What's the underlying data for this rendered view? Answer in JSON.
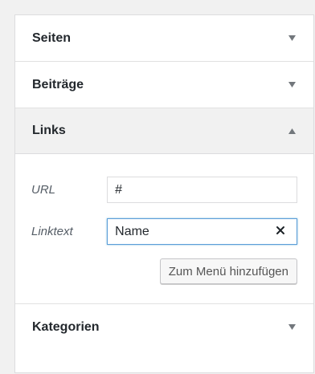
{
  "accordion": {
    "sections": [
      {
        "title": "Seiten",
        "state": "collapsed",
        "arrow_icon": "arrow-down-icon"
      },
      {
        "title": "Beiträge",
        "state": "collapsed",
        "arrow_icon": "arrow-down-icon"
      },
      {
        "title": "Links",
        "state": "expanded",
        "arrow_icon": "arrow-up-icon"
      },
      {
        "title": "Kategorien",
        "state": "collapsed",
        "arrow_icon": "arrow-down-icon"
      }
    ]
  },
  "links_form": {
    "url_label": "URL",
    "url_value": "#",
    "linktext_label": "Linktext",
    "linktext_value": "Name",
    "clear_icon": "close-icon",
    "add_button_label": "Zum Menü hinzufügen"
  },
  "colors": {
    "page_background": "#f1f1f1",
    "panel_background": "#ffffff",
    "focus_border": "#5b9dd9",
    "text": "#23282d",
    "arrow": "#72777c"
  }
}
